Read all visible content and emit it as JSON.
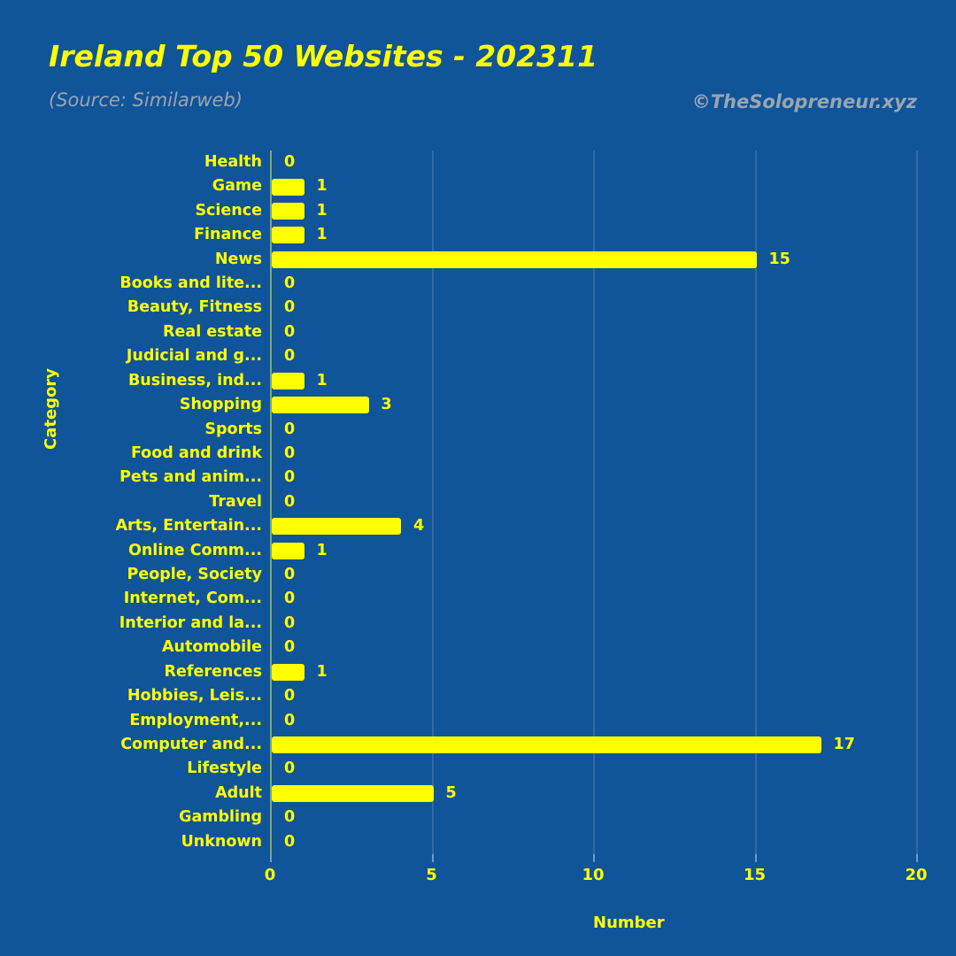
{
  "header": {
    "title": "Ireland Top 50 Websites - 202311",
    "subtitle": "(Source: Similarweb)",
    "attribution": "©TheSolopreneur.xyz"
  },
  "colors": {
    "background": "#10549A",
    "bar": "#FFFF00",
    "text": "#FFFF00",
    "muted": "#9AA5AE",
    "gridline": "#2E6BA8",
    "axis": "#7FA96B"
  },
  "chart_data": {
    "type": "bar",
    "orientation": "horizontal",
    "title": "Ireland Top 50 Websites - 202311",
    "subtitle": "(Source: Similarweb)",
    "xlabel": "Number",
    "ylabel": "Category",
    "xlim": [
      0,
      20
    ],
    "xticks": [
      0,
      5,
      10,
      15,
      20
    ],
    "xticklabels": [
      "0",
      "5",
      "10",
      "15",
      "20"
    ],
    "grid": true,
    "legend": false,
    "data_labels": true,
    "categories": [
      "Health",
      "Game",
      "Science",
      "Finance",
      "News",
      "Books and lite...",
      "Beauty, Fitness",
      "Real estate",
      "Judicial and g...",
      "Business, ind...",
      "Shopping",
      "Sports",
      "Food and drink",
      "Pets and anim...",
      "Travel",
      "Arts, Entertain...",
      "Online Comm...",
      "People,  Society",
      "Internet, Com...",
      "Interior and la...",
      "Automobile",
      "References",
      "Hobbies, Leis...",
      "Employment,...",
      "Computer and...",
      "Lifestyle",
      "Adult",
      "Gambling",
      "Unknown"
    ],
    "values": [
      0,
      1,
      1,
      1,
      15,
      0,
      0,
      0,
      0,
      1,
      3,
      0,
      0,
      0,
      0,
      4,
      1,
      0,
      0,
      0,
      0,
      1,
      0,
      0,
      17,
      0,
      5,
      0,
      0
    ],
    "value_labels": [
      "0",
      "1",
      "1",
      "1",
      "15",
      "0",
      "0",
      "0",
      "0",
      "1",
      "3",
      "0",
      "0",
      "0",
      "0",
      "4",
      "1",
      "0",
      "0",
      "0",
      "0",
      "1",
      "0",
      "0",
      "17",
      "0",
      "5",
      "0",
      "0"
    ]
  }
}
